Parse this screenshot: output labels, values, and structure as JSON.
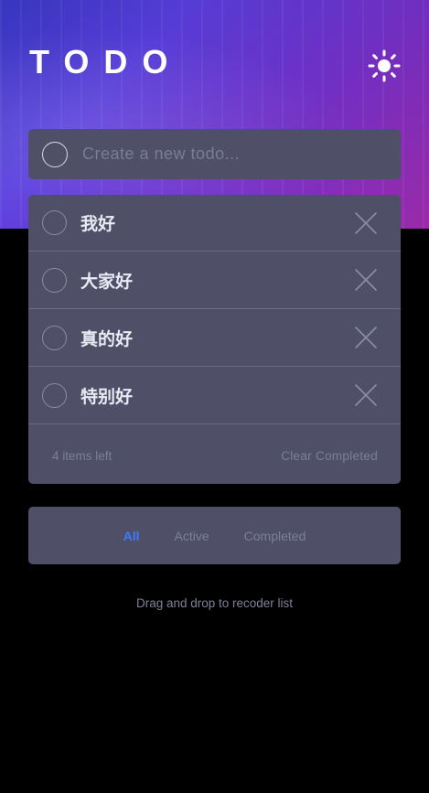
{
  "header": {
    "title": "TODO",
    "theme_icon": "sun-icon"
  },
  "new_todo": {
    "placeholder": "Create a new todo..."
  },
  "todos": [
    {
      "text": "我好",
      "completed": false
    },
    {
      "text": "大家好",
      "completed": false
    },
    {
      "text": "真的好",
      "completed": false
    },
    {
      "text": "特别好",
      "completed": false
    }
  ],
  "footer": {
    "items_left": "4 items left",
    "clear_label": "Clear Completed"
  },
  "filters": {
    "all": "All",
    "active": "Active",
    "completed": "Completed",
    "selected": "All"
  },
  "hint": "Drag and drop to recoder list",
  "colors": {
    "card": "#4f5068",
    "accent": "#3a7bfd",
    "muted_text": "#7d7e97",
    "background": "#000000"
  }
}
